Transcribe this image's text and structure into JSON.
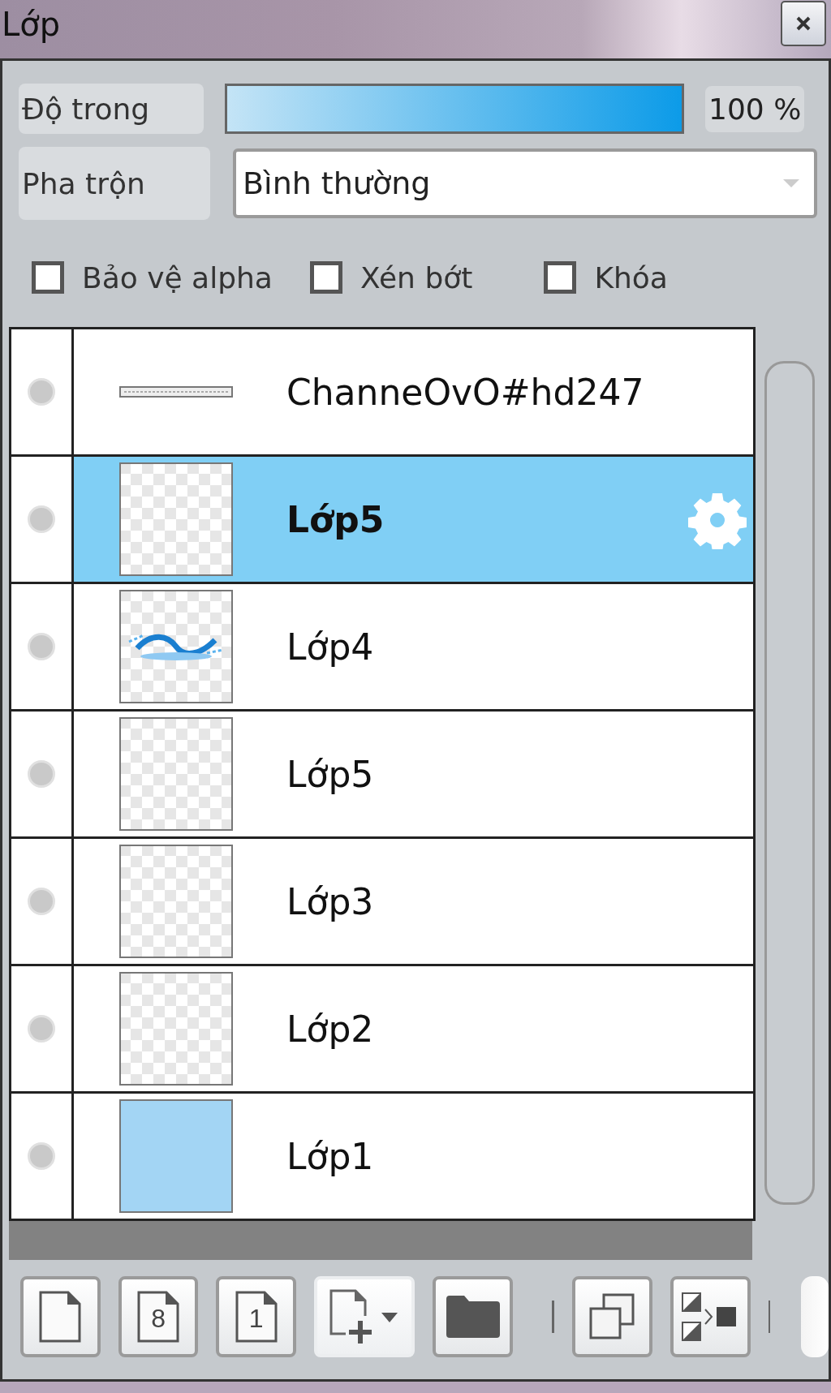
{
  "window": {
    "title": "Lớp"
  },
  "opacity": {
    "label": "Độ trong",
    "level": 1,
    "reading": "100 %"
  },
  "blend": {
    "label": "Pha trộn",
    "value": "Bình thường"
  },
  "options": [
    {
      "label": "Bảo vệ alpha",
      "checked": false
    },
    {
      "label": "Xén bớt",
      "checked": false
    },
    {
      "label": "Khóa",
      "checked": false
    }
  ],
  "layers": [
    {
      "name": "ChanneOvO#hd247",
      "selected": false,
      "kind": "line"
    },
    {
      "name": "Lớp5",
      "selected": true,
      "kind": "empty"
    },
    {
      "name": "Lớp4",
      "selected": false,
      "kind": "art"
    },
    {
      "name": "Lớp5",
      "selected": false,
      "kind": "empty"
    },
    {
      "name": "Lớp3",
      "selected": false,
      "kind": "empty"
    },
    {
      "name": "Lớp2",
      "selected": false,
      "kind": "empty"
    },
    {
      "name": "Lớp1",
      "selected": false,
      "kind": "fill",
      "color": "#a3d5f4"
    }
  ],
  "toolbar": [
    {
      "kind": "page"
    },
    {
      "kind": "page",
      "digit": "8"
    },
    {
      "kind": "page",
      "digit": "1"
    },
    {
      "kind": "add"
    },
    {
      "kind": "folder"
    },
    {
      "kind": "duplicate"
    },
    {
      "kind": "merge"
    }
  ]
}
